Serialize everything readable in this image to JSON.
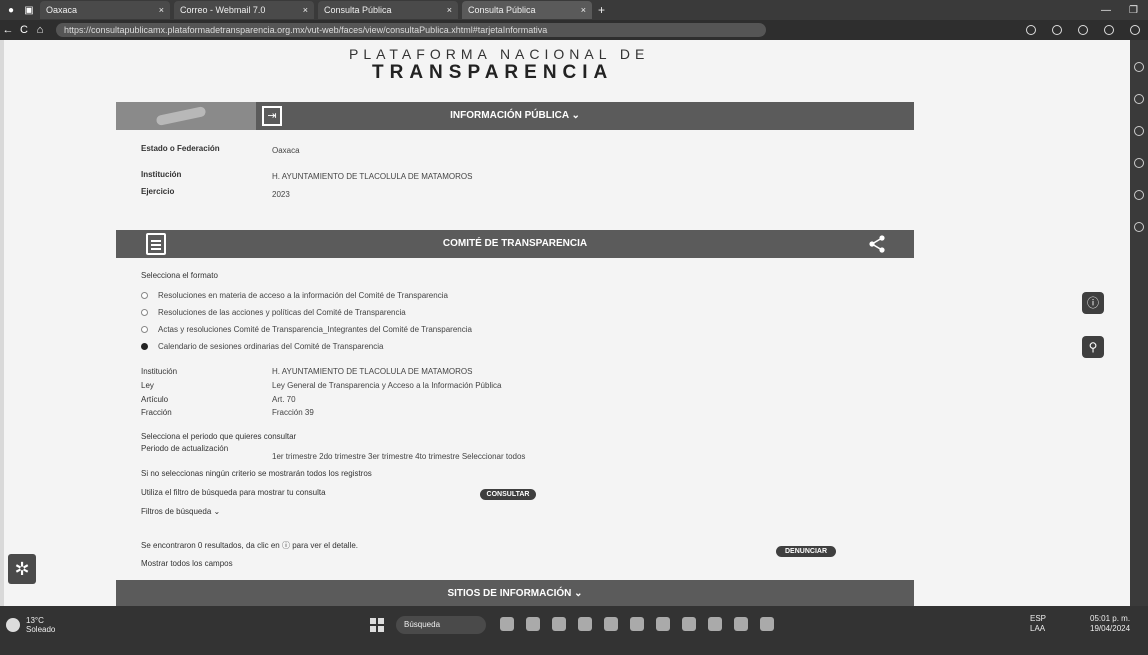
{
  "browser": {
    "tabs": [
      {
        "label": "Oaxaca"
      },
      {
        "label": "Correo - Webmail 7.0"
      },
      {
        "label": "Consulta Pública"
      },
      {
        "label": "Consulta Pública"
      }
    ],
    "url": "https://consultapublicamx.plataformadetransparencia.org.mx/vut-web/faces/view/consultaPublica.xhtml#tarjetaInformativa"
  },
  "header": {
    "brand_line1": "PLATAFORMA NACIONAL DE",
    "brand_line2": "TRANSPARENCIA"
  },
  "info_band": {
    "title": "INFORMACIÓN PÚBLICA ⌄"
  },
  "filters": {
    "estado_label": "Estado o Federación",
    "estado_value": "Oaxaca",
    "institucion_label": "Institución",
    "institucion_value": "H. AYUNTAMIENTO DE TLACOLULA DE MATAMOROS",
    "ejercicio_label": "Ejercicio",
    "ejercicio_value": "2023"
  },
  "comite_band": {
    "title": "COMITÉ DE TRANSPARENCIA"
  },
  "formats": {
    "heading": "Selecciona el formato",
    "options": [
      {
        "label": "Resoluciones en materia de acceso a la información del Comité de Transparencia",
        "selected": false
      },
      {
        "label": "Resoluciones de las acciones y políticas del Comité de Transparencia",
        "selected": false
      },
      {
        "label": "Actas y resoluciones Comité de Transparencia_Integrantes del Comité de Transparencia",
        "selected": false
      },
      {
        "label": "Calendario de sesiones ordinarias del Comité de Transparencia",
        "selected": true
      }
    ]
  },
  "details": {
    "institucion_label": "Institución",
    "institucion_value": "H. AYUNTAMIENTO DE TLACOLULA DE MATAMOROS",
    "ley_label": "Ley",
    "ley_value": "Ley General de Transparencia y Acceso a la Información Pública",
    "articulo_label": "Artículo",
    "articulo_value": "Art. 70",
    "fraccion_label": "Fracción",
    "fraccion_value": "Fracción 39"
  },
  "period": {
    "heading": "Selecciona el periodo que quieres consultar",
    "label": "Periodo de actualización",
    "options": "1er trimestre   2do trimestre   3er trimestre   4to trimestre   Seleccionar todos"
  },
  "search_note": "Si no seleccionas ningún criterio se mostrarán todos los registros",
  "consult_prompt": "Utiliza el filtro de búsqueda para mostrar tu consulta",
  "consult_button": "CONSULTAR",
  "filters_toggle": "Filtros de búsqueda ⌄",
  "results_note": "Se encontraron 0 resultados, da clic en ⓘ para ver el detalle.",
  "denunciar_button": "DENUNCIAR",
  "campos_note": "Mostrar todos los campos",
  "sitios_band": {
    "title": "SITIOS DE INFORMACIÓN ⌄"
  },
  "taskbar": {
    "weather_temp": "13°C",
    "weather_desc": "Soleado",
    "search_placeholder": "Búsqueda",
    "tray_lang": "ESP",
    "tray_region": "LAA",
    "time": "05:01 p. m.",
    "date": "19/04/2024"
  }
}
